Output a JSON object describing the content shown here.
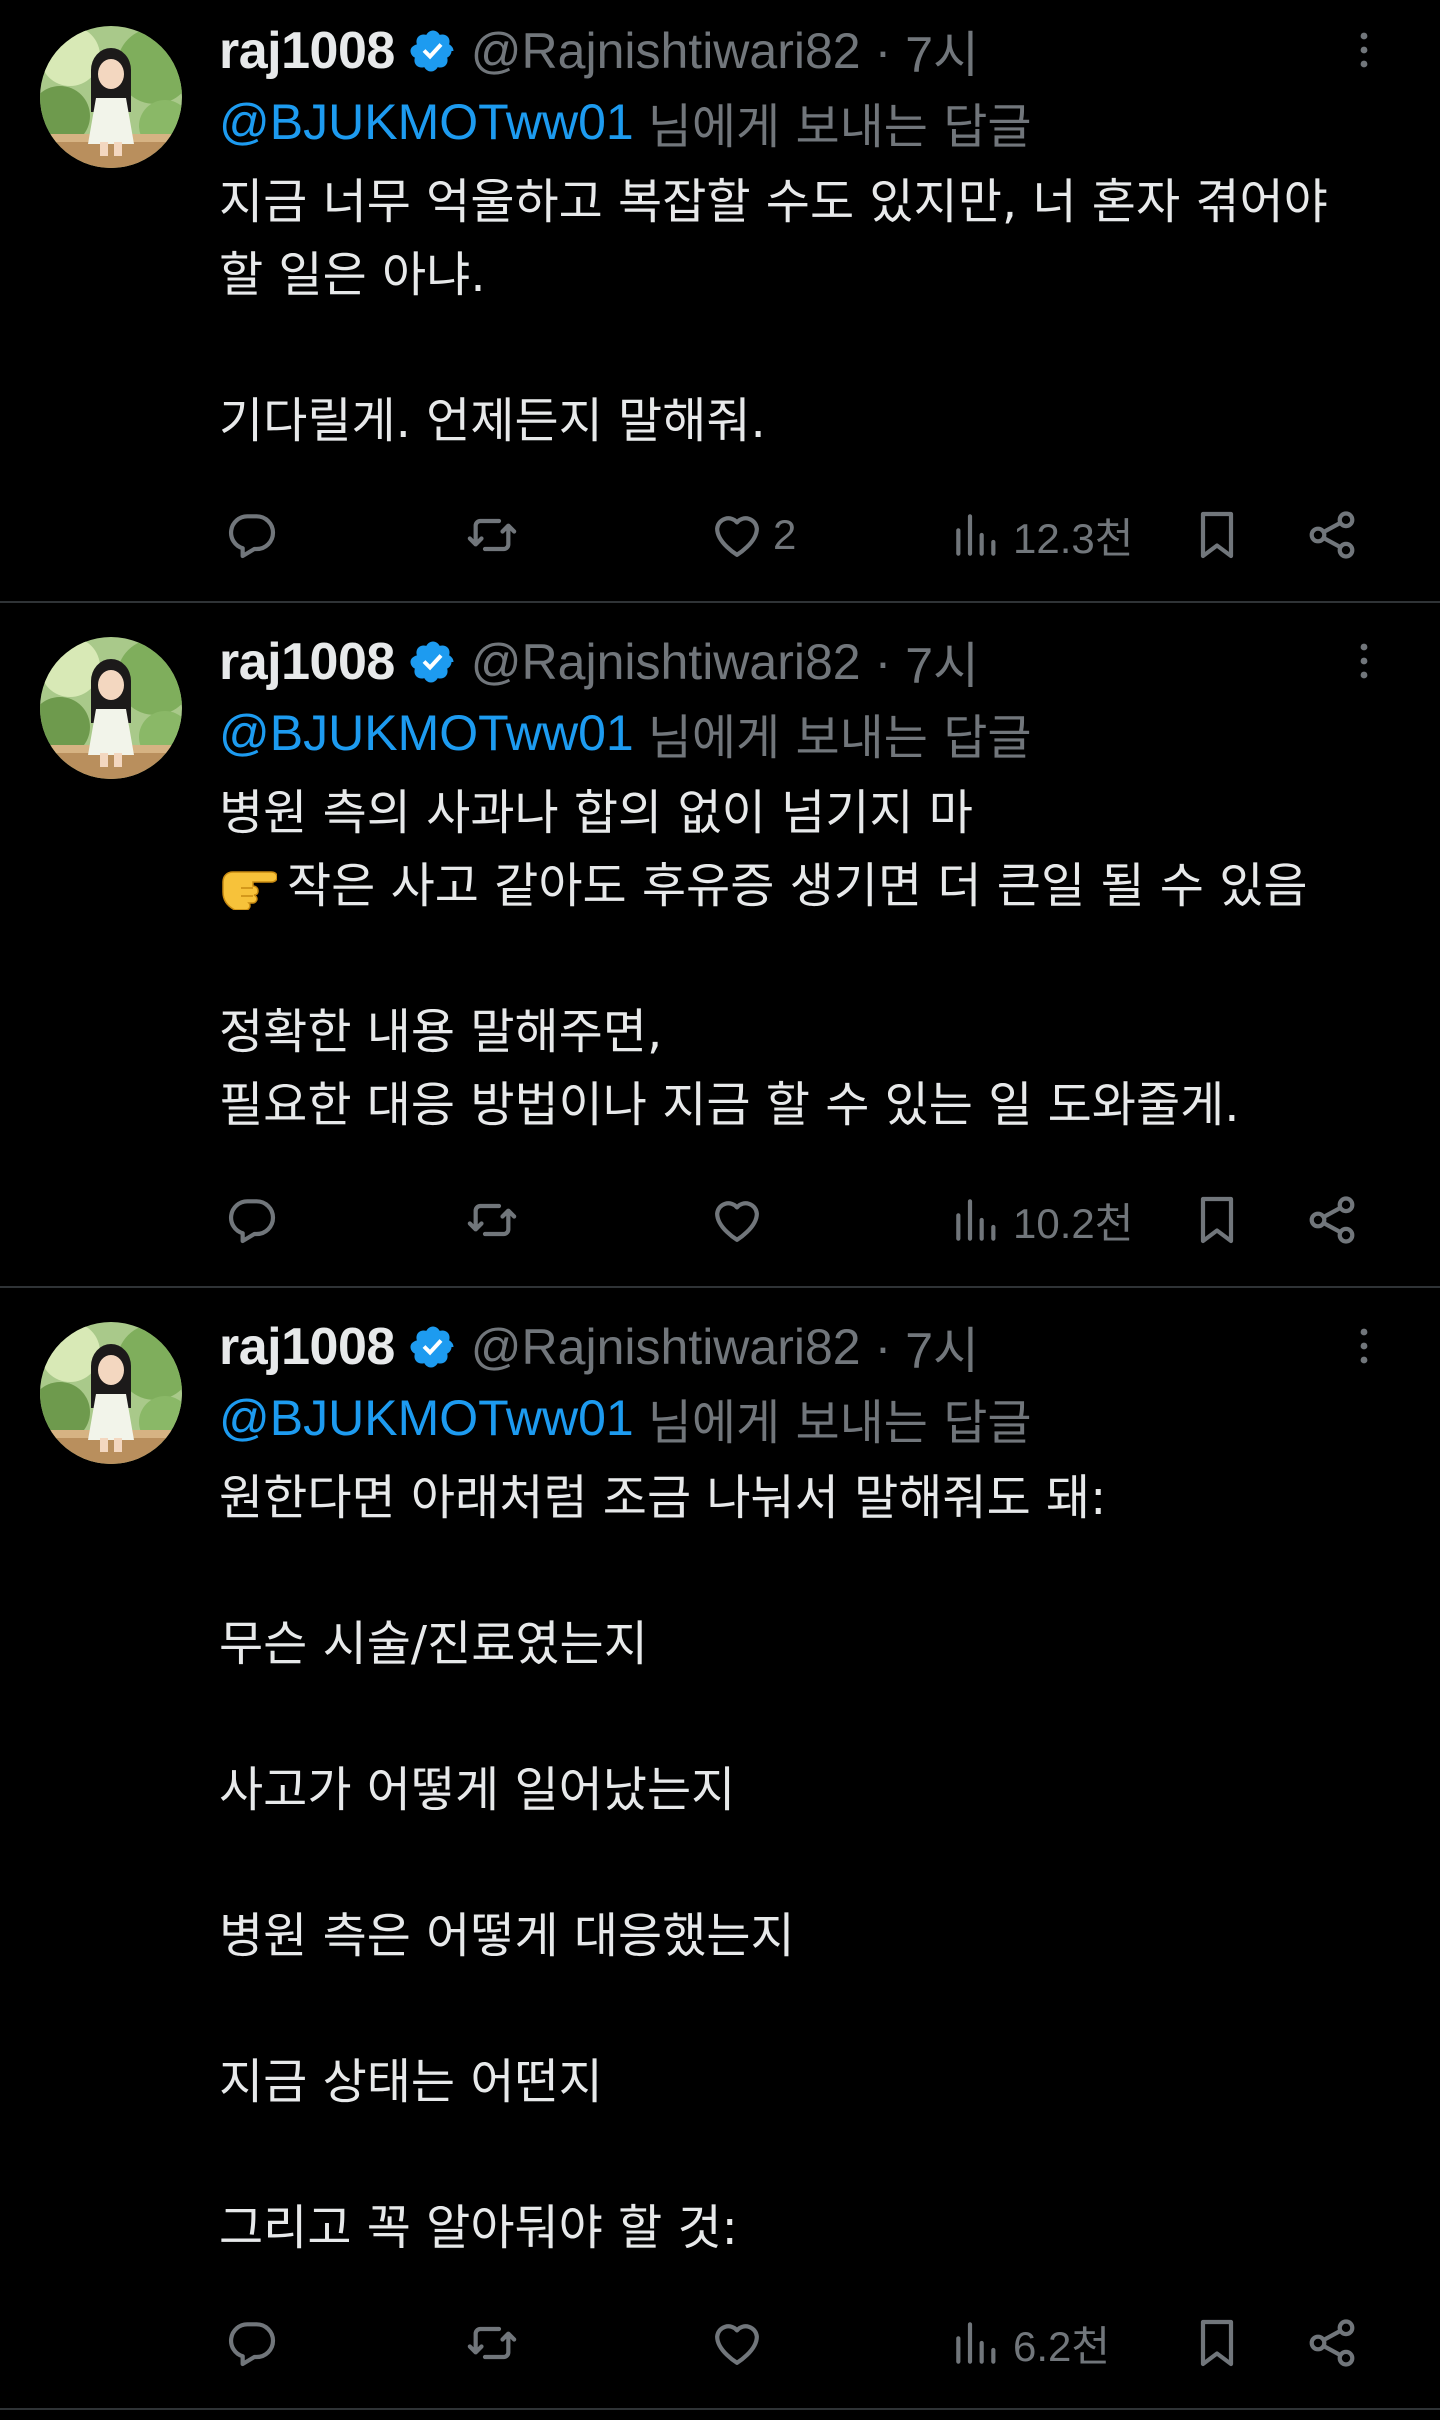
{
  "colors": {
    "background": "#000000",
    "text": "#e7e9ea",
    "muted": "#71767b",
    "accent": "#1d9bf0",
    "divider": "#2f3336"
  },
  "tweets": [
    {
      "author": {
        "name": "raj1008",
        "handle": "@Rajnishtiwari82",
        "verified": true,
        "avatar_icon": "avatar-girl-in-garden"
      },
      "separator": "·",
      "time": "7시",
      "reply_to": {
        "mention": "@BJUKMOTww01",
        "suffix": "님에게 보내는 답글"
      },
      "body": [
        "지금 너무 억울하고 복잡할 수도 있지만, 너 혼자 겪어야",
        "할 일은 아냐.",
        "",
        "기다릴게. 언제든지 말해줘."
      ],
      "actions": {
        "reply_count": "",
        "retweet_count": "",
        "like_count": "2",
        "views_count": "12.3천"
      }
    },
    {
      "author": {
        "name": "raj1008",
        "handle": "@Rajnishtiwari82",
        "verified": true,
        "avatar_icon": "avatar-girl-in-garden"
      },
      "separator": "·",
      "time": "7시",
      "reply_to": {
        "mention": "@BJUKMOTww01",
        "suffix": "님에게 보내는 답글"
      },
      "body": [
        "병원 측의 사과나 합의 없이 넘기지 마",
        "작은 사고 같아도 후유증 생기면 더 큰일 될 수 있음",
        "",
        "정확한 내용 말해주면,",
        "필요한 대응 방법이나 지금 할 수 있는 일 도와줄게."
      ],
      "body_emoji_line": 1,
      "body_emoji_icon": "backhand-index-pointing-right-icon",
      "actions": {
        "reply_count": "",
        "retweet_count": "",
        "like_count": "",
        "views_count": "10.2천"
      }
    },
    {
      "author": {
        "name": "raj1008",
        "handle": "@Rajnishtiwari82",
        "verified": true,
        "avatar_icon": "avatar-girl-in-garden"
      },
      "separator": "·",
      "time": "7시",
      "reply_to": {
        "mention": "@BJUKMOTww01",
        "suffix": "님에게 보내는 답글"
      },
      "body": [
        "원한다면 아래처럼 조금 나눠서 말해줘도 돼:",
        "",
        "무슨 시술/진료였는지",
        "",
        "사고가 어떻게 일어났는지",
        "",
        "병원 측은 어떻게 대응했는지",
        "",
        "지금 상태는 어떤지",
        "",
        "그리고 꼭 알아둬야 할 것:"
      ],
      "actions": {
        "reply_count": "",
        "retweet_count": "",
        "like_count": "",
        "views_count": "6.2천"
      }
    }
  ]
}
